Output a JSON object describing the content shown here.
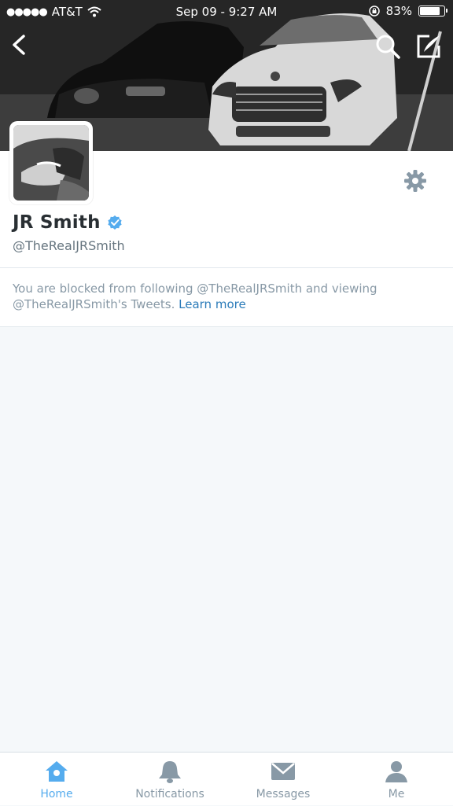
{
  "status_bar": {
    "carrier": "AT&T",
    "datetime": "Sep 09 - 9:27 AM",
    "battery_percent": 83,
    "battery_label": "83%"
  },
  "nav": {
    "back_icon": "chevron-left-icon",
    "search_icon": "search-icon",
    "compose_icon": "compose-tweet-icon"
  },
  "profile": {
    "name": "JR Smith",
    "verified": true,
    "handle": "@TheRealJRSmith"
  },
  "blocked_notice": {
    "text": "You are blocked from following @TheRealJRSmith and viewing @TheRealJRSmith's Tweets.",
    "link_label": "Learn more"
  },
  "tabs": [
    {
      "label": "Home",
      "icon": "home-icon",
      "active": true
    },
    {
      "label": "Notifications",
      "icon": "bell-icon",
      "active": false
    },
    {
      "label": "Messages",
      "icon": "envelope-icon",
      "active": false
    },
    {
      "label": "Me",
      "icon": "person-icon",
      "active": false
    }
  ],
  "colors": {
    "accent": "#55acee",
    "link": "#2b7bb9",
    "muted_text": "#8899a6",
    "background": "#f5f8fa"
  }
}
